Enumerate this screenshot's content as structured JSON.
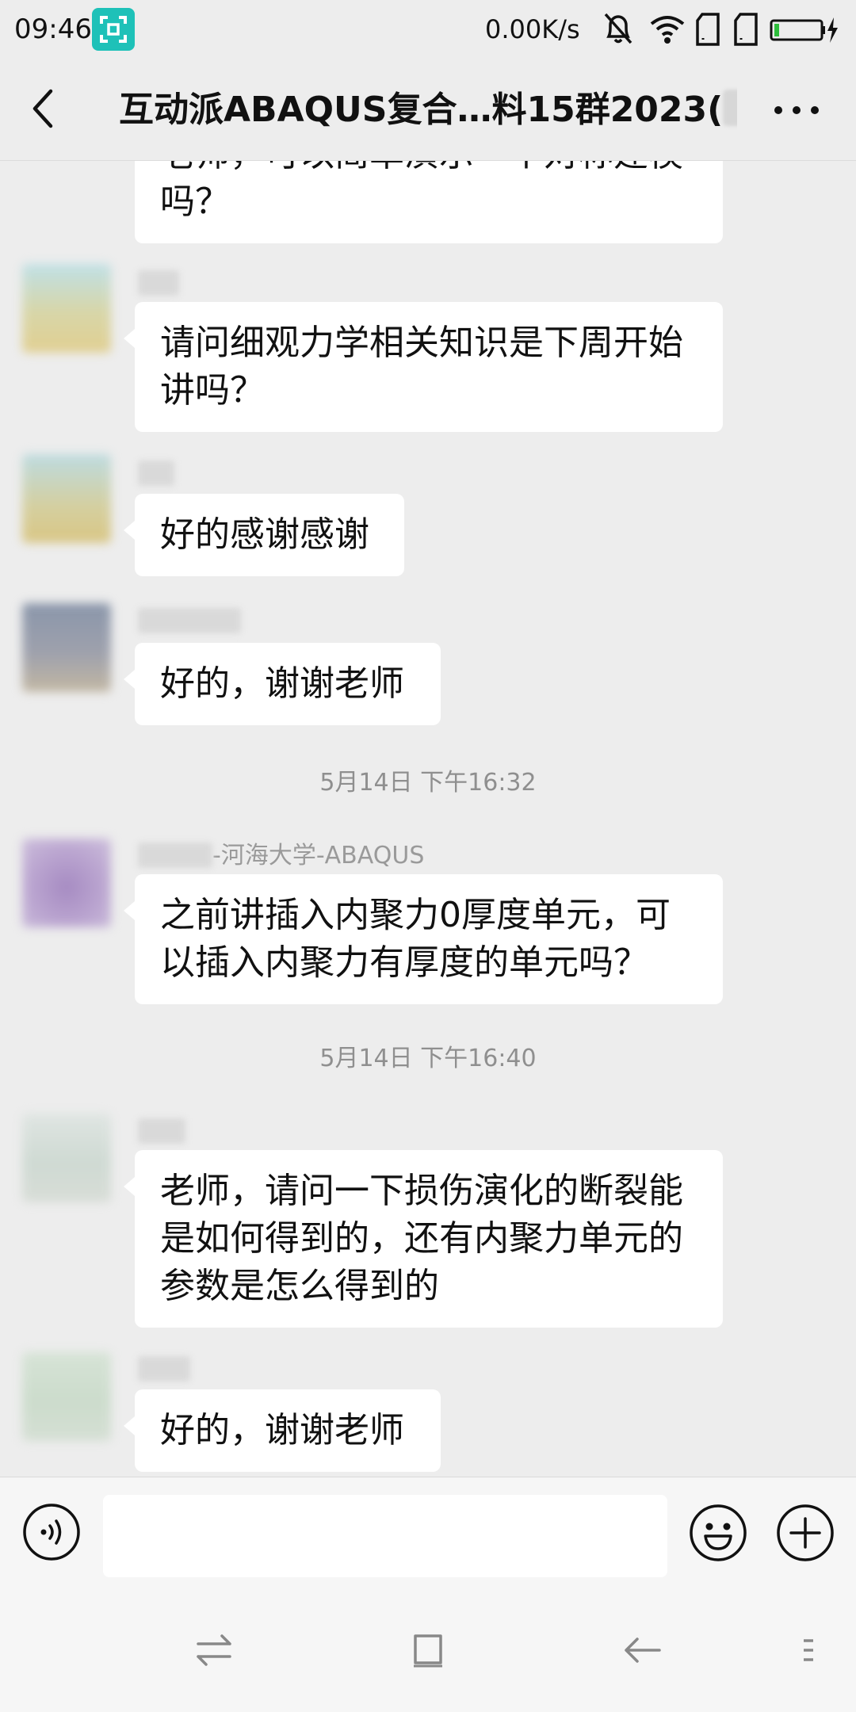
{
  "status_bar": {
    "time": "09:46",
    "network_speed": "0.00K/s",
    "icons": [
      "screen-scan-icon",
      "mute-bell-icon",
      "wifi-icon",
      "sim1-icon",
      "sim2-icon",
      "battery-charging-icon"
    ]
  },
  "header": {
    "title": "互动派ABAQUS复合…料15群2023(",
    "title_end": ")",
    "back_icon": "chevron-left-icon",
    "more_icon": "more-dots-icon"
  },
  "messages": [
    {
      "sender": "",
      "text": "老师，可以简单演示一个对称建模\n吗？"
    },
    {
      "sender": "",
      "text": "请问细观力学相关知识是下周开始\n讲吗？"
    },
    {
      "sender": "",
      "text": "好的感谢感谢"
    },
    {
      "sender": "",
      "text": "好的，谢谢老师"
    },
    {
      "sender": "-河海大学-ABAQUS",
      "text": "之前讲插入内聚力0厚度单元，可\n以插入内聚力有厚度的单元吗？"
    },
    {
      "sender": "",
      "text": "老师，请问一下损伤演化的断裂能\n是如何得到的，还有内聚力单元的\n参数是怎么得到的"
    },
    {
      "sender": "",
      "text": "好的，谢谢老师"
    }
  ],
  "timestamps": [
    "5月14日 下午16:32",
    "5月14日 下午16:40"
  ],
  "input_bar": {
    "placeholder": "",
    "icons": [
      "voice-icon",
      "emoji-icon",
      "plus-icon"
    ]
  },
  "nav_bar": {
    "icons": [
      "switch-apps-icon",
      "home-square-icon",
      "back-arrow-icon",
      "menu-icon"
    ]
  },
  "colors": {
    "background": "#ededed",
    "bubble": "#ffffff",
    "accent": "#1ec1b8"
  }
}
